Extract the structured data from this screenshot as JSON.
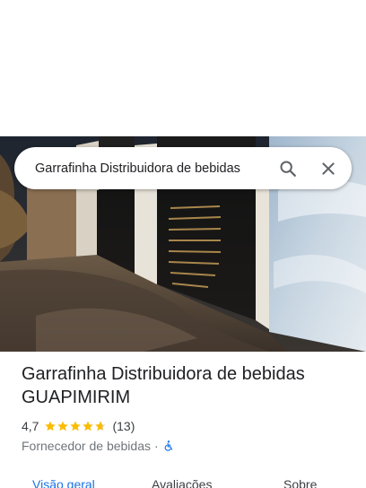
{
  "search": {
    "value": "Garrafinha Distribuidora de bebidas",
    "search_icon": "search-icon",
    "close_icon": "close-icon"
  },
  "hero": {
    "description_icon": "storefront-photo"
  },
  "place": {
    "title": "Garrafinha Distribuidora de bebidas GUAPIMIRIM",
    "rating": "4,7",
    "rating_value": 4.7,
    "review_count": "(13)",
    "category": "Fornecedor de bebidas",
    "separator": "·",
    "accessibility_icon": "wheelchair-icon",
    "star_color": "#fbbc04",
    "accessibility_color": "#1a73e8"
  },
  "tabs": [
    {
      "label": "Visão geral",
      "active": true
    },
    {
      "label": "Avaliações",
      "active": false
    },
    {
      "label": "Sobre",
      "active": false
    }
  ],
  "colors": {
    "accent": "#1a73e8",
    "text": "#202124",
    "secondary_text": "#70757a"
  }
}
